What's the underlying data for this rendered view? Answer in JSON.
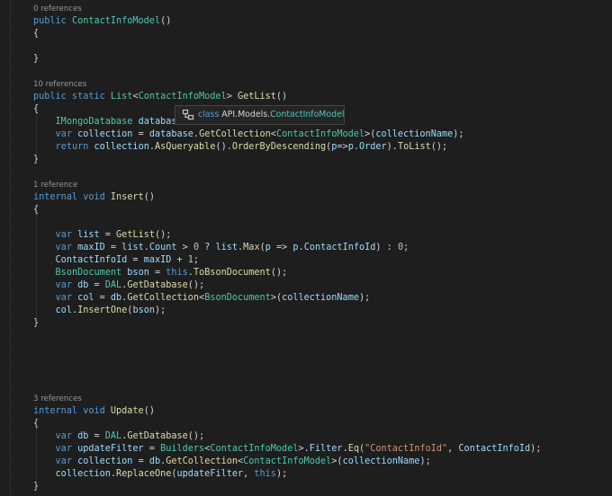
{
  "colors": {
    "background": "#1e1e1e",
    "keyword": "#569cd6",
    "type": "#4ec9b0",
    "method": "#dcdcaa",
    "variable": "#9cdcfe",
    "string": "#ce9178",
    "number": "#b5cea8",
    "text": "#d4d4d4",
    "codelens": "#999999"
  },
  "tooltip": {
    "icon": "class-icon",
    "keyword": "class",
    "namespace": "API.Models.",
    "class_name": "ContactInfoModel"
  },
  "lines": [
    {
      "name": "codelens-constructor",
      "tokens": [
        [
          "ref",
          "0 references"
        ]
      ]
    },
    {
      "name": "code-line",
      "tokens": [
        [
          "kw",
          "public "
        ],
        [
          "ty",
          "ContactInfoModel"
        ],
        [
          "pl",
          "()"
        ]
      ]
    },
    {
      "name": "code-line",
      "tokens": [
        [
          "pl",
          "{"
        ]
      ]
    },
    {
      "name": "code-line",
      "tokens": []
    },
    {
      "name": "code-line",
      "tokens": [
        [
          "pl",
          "}"
        ]
      ]
    },
    {
      "name": "code-line",
      "tokens": []
    },
    {
      "name": "codelens-getlist",
      "tokens": [
        [
          "ref",
          "10 references"
        ]
      ]
    },
    {
      "name": "code-line",
      "tokens": [
        [
          "kw",
          "public static "
        ],
        [
          "ty",
          "List"
        ],
        [
          "pl",
          "<"
        ],
        [
          "ty",
          "ContactInfoModel"
        ],
        [
          "pl",
          "> "
        ],
        [
          "fn",
          "GetList"
        ],
        [
          "pl",
          "()"
        ]
      ]
    },
    {
      "name": "code-line",
      "tokens": [
        [
          "pl",
          "{"
        ]
      ]
    },
    {
      "name": "code-line",
      "tokens": [
        [
          "pl",
          "    "
        ],
        [
          "ty",
          "IMongoDatabase"
        ],
        [
          "pl",
          " "
        ],
        [
          "vr",
          "databas"
        ]
      ]
    },
    {
      "name": "code-line",
      "tokens": [
        [
          "pl",
          "    "
        ],
        [
          "kw",
          "var"
        ],
        [
          "pl",
          " "
        ],
        [
          "vr",
          "collection"
        ],
        [
          "pl",
          " = "
        ],
        [
          "vr",
          "database"
        ],
        [
          "pl",
          "."
        ],
        [
          "fn",
          "GetCollection"
        ],
        [
          "pl",
          "<"
        ],
        [
          "ty",
          "ContactInfoModel"
        ],
        [
          "pl",
          ">("
        ],
        [
          "vr",
          "collectionName"
        ],
        [
          "pl",
          ");"
        ]
      ]
    },
    {
      "name": "code-line",
      "tokens": [
        [
          "pl",
          "    "
        ],
        [
          "kw",
          "return"
        ],
        [
          "pl",
          " "
        ],
        [
          "vr",
          "collection"
        ],
        [
          "pl",
          "."
        ],
        [
          "fn",
          "AsQueryable"
        ],
        [
          "pl",
          "()."
        ],
        [
          "fn",
          "OrderByDescending"
        ],
        [
          "pl",
          "("
        ],
        [
          "vr",
          "p"
        ],
        [
          "pl",
          "=>"
        ],
        [
          "vr",
          "p"
        ],
        [
          "pl",
          "."
        ],
        [
          "vr",
          "Order"
        ],
        [
          "pl",
          ")."
        ],
        [
          "fn",
          "ToList"
        ],
        [
          "pl",
          "();"
        ]
      ]
    },
    {
      "name": "code-line",
      "tokens": [
        [
          "pl",
          "}"
        ]
      ]
    },
    {
      "name": "code-line",
      "tokens": []
    },
    {
      "name": "codelens-insert",
      "tokens": [
        [
          "ref",
          "1 reference"
        ]
      ]
    },
    {
      "name": "code-line",
      "tokens": [
        [
          "kw",
          "internal void "
        ],
        [
          "fn",
          "Insert"
        ],
        [
          "pl",
          "()"
        ]
      ]
    },
    {
      "name": "code-line",
      "tokens": [
        [
          "pl",
          "{"
        ]
      ]
    },
    {
      "name": "code-line",
      "tokens": []
    },
    {
      "name": "code-line",
      "tokens": [
        [
          "pl",
          "    "
        ],
        [
          "kw",
          "var"
        ],
        [
          "pl",
          " "
        ],
        [
          "vr",
          "list"
        ],
        [
          "pl",
          " = "
        ],
        [
          "fn",
          "GetList"
        ],
        [
          "pl",
          "();"
        ]
      ]
    },
    {
      "name": "code-line",
      "tokens": [
        [
          "pl",
          "    "
        ],
        [
          "kw",
          "var"
        ],
        [
          "pl",
          " "
        ],
        [
          "vr",
          "maxID"
        ],
        [
          "pl",
          " = "
        ],
        [
          "vr",
          "list"
        ],
        [
          "pl",
          "."
        ],
        [
          "vr",
          "Count"
        ],
        [
          "pl",
          " > "
        ],
        [
          "nm",
          "0"
        ],
        [
          "pl",
          " ? "
        ],
        [
          "vr",
          "list"
        ],
        [
          "pl",
          "."
        ],
        [
          "fn",
          "Max"
        ],
        [
          "pl",
          "("
        ],
        [
          "vr",
          "p"
        ],
        [
          "pl",
          " => "
        ],
        [
          "vr",
          "p"
        ],
        [
          "pl",
          "."
        ],
        [
          "vr",
          "ContactInfoId"
        ],
        [
          "pl",
          ") : "
        ],
        [
          "nm",
          "0"
        ],
        [
          "pl",
          ";"
        ]
      ]
    },
    {
      "name": "code-line",
      "tokens": [
        [
          "pl",
          "    "
        ],
        [
          "vr",
          "ContactInfoId"
        ],
        [
          "pl",
          " = "
        ],
        [
          "vr",
          "maxID"
        ],
        [
          "pl",
          " + "
        ],
        [
          "nm",
          "1"
        ],
        [
          "pl",
          ";"
        ]
      ]
    },
    {
      "name": "code-line",
      "tokens": [
        [
          "pl",
          "    "
        ],
        [
          "ty",
          "BsonDocument"
        ],
        [
          "pl",
          " "
        ],
        [
          "vr",
          "bson"
        ],
        [
          "pl",
          " = "
        ],
        [
          "kw",
          "this"
        ],
        [
          "pl",
          "."
        ],
        [
          "fn",
          "ToBsonDocument"
        ],
        [
          "pl",
          "();"
        ]
      ]
    },
    {
      "name": "code-line",
      "tokens": [
        [
          "pl",
          "    "
        ],
        [
          "kw",
          "var"
        ],
        [
          "pl",
          " "
        ],
        [
          "vr",
          "db"
        ],
        [
          "pl",
          " = "
        ],
        [
          "ty",
          "DAL"
        ],
        [
          "pl",
          "."
        ],
        [
          "fn",
          "GetDatabase"
        ],
        [
          "pl",
          "();"
        ]
      ]
    },
    {
      "name": "code-line",
      "tokens": [
        [
          "pl",
          "    "
        ],
        [
          "kw",
          "var"
        ],
        [
          "pl",
          " "
        ],
        [
          "vr",
          "col"
        ],
        [
          "pl",
          " = "
        ],
        [
          "vr",
          "db"
        ],
        [
          "pl",
          "."
        ],
        [
          "fn",
          "GetCollection"
        ],
        [
          "pl",
          "<"
        ],
        [
          "ty",
          "BsonDocument"
        ],
        [
          "pl",
          ">("
        ],
        [
          "vr",
          "collectionName"
        ],
        [
          "pl",
          ");"
        ]
      ]
    },
    {
      "name": "code-line",
      "tokens": [
        [
          "pl",
          "    "
        ],
        [
          "vr",
          "col"
        ],
        [
          "pl",
          "."
        ],
        [
          "fn",
          "InsertOne"
        ],
        [
          "pl",
          "("
        ],
        [
          "vr",
          "bson"
        ],
        [
          "pl",
          ");"
        ]
      ]
    },
    {
      "name": "code-line",
      "tokens": [
        [
          "pl",
          "}"
        ]
      ]
    },
    {
      "name": "code-line",
      "tokens": []
    },
    {
      "name": "code-line",
      "tokens": []
    },
    {
      "name": "code-line",
      "tokens": []
    },
    {
      "name": "code-line",
      "tokens": []
    },
    {
      "name": "code-line",
      "tokens": []
    },
    {
      "name": "codelens-update",
      "tokens": [
        [
          "ref",
          "3 references"
        ]
      ]
    },
    {
      "name": "code-line",
      "tokens": [
        [
          "kw",
          "internal void "
        ],
        [
          "fn",
          "Update"
        ],
        [
          "pl",
          "()"
        ]
      ]
    },
    {
      "name": "code-line",
      "tokens": [
        [
          "pl",
          "{"
        ]
      ]
    },
    {
      "name": "code-line",
      "tokens": [
        [
          "pl",
          "    "
        ],
        [
          "kw",
          "var"
        ],
        [
          "pl",
          " "
        ],
        [
          "vr",
          "db"
        ],
        [
          "pl",
          " = "
        ],
        [
          "ty",
          "DAL"
        ],
        [
          "pl",
          "."
        ],
        [
          "fn",
          "GetDatabase"
        ],
        [
          "pl",
          "();"
        ]
      ]
    },
    {
      "name": "code-line",
      "tokens": [
        [
          "pl",
          "    "
        ],
        [
          "kw",
          "var"
        ],
        [
          "pl",
          " "
        ],
        [
          "vr",
          "updateFilter"
        ],
        [
          "pl",
          " = "
        ],
        [
          "ty",
          "Builders"
        ],
        [
          "pl",
          "<"
        ],
        [
          "ty",
          "ContactInfoModel"
        ],
        [
          "pl",
          ">."
        ],
        [
          "vr",
          "Filter"
        ],
        [
          "pl",
          "."
        ],
        [
          "fn",
          "Eq"
        ],
        [
          "pl",
          "("
        ],
        [
          "st",
          "\"ContactInfoId\""
        ],
        [
          "pl",
          ", "
        ],
        [
          "vr",
          "ContactInfoId"
        ],
        [
          "pl",
          ");"
        ]
      ]
    },
    {
      "name": "code-line",
      "tokens": [
        [
          "pl",
          "    "
        ],
        [
          "kw",
          "var"
        ],
        [
          "pl",
          " "
        ],
        [
          "vr",
          "collection"
        ],
        [
          "pl",
          " = "
        ],
        [
          "vr",
          "db"
        ],
        [
          "pl",
          "."
        ],
        [
          "fn",
          "GetCollection"
        ],
        [
          "pl",
          "<"
        ],
        [
          "ty",
          "ContactInfoModel"
        ],
        [
          "pl",
          ">("
        ],
        [
          "vr",
          "collectionName"
        ],
        [
          "pl",
          ");"
        ]
      ]
    },
    {
      "name": "code-line",
      "tokens": [
        [
          "pl",
          "    "
        ],
        [
          "vr",
          "collection"
        ],
        [
          "pl",
          "."
        ],
        [
          "fn",
          "ReplaceOne"
        ],
        [
          "pl",
          "("
        ],
        [
          "vr",
          "updateFilter"
        ],
        [
          "pl",
          ", "
        ],
        [
          "kw",
          "this"
        ],
        [
          "pl",
          ");"
        ]
      ]
    },
    {
      "name": "code-line",
      "tokens": [
        [
          "pl",
          "}"
        ]
      ]
    }
  ]
}
